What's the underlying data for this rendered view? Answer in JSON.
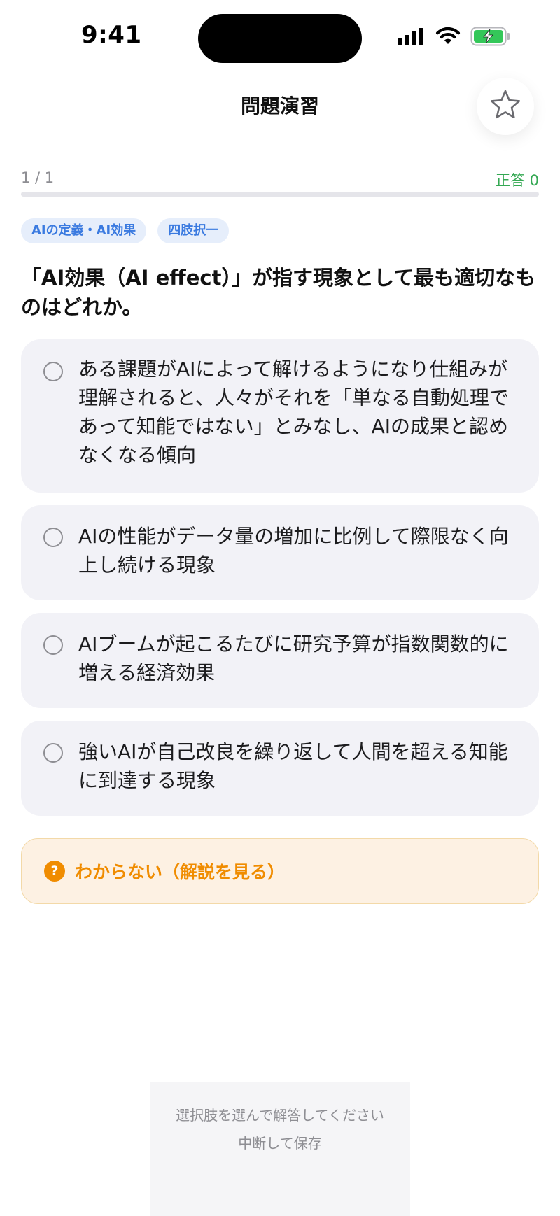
{
  "status_bar": {
    "time": "9:41"
  },
  "header": {
    "title": "問題演習",
    "star_icon": "star-outline-icon"
  },
  "progress": {
    "label": "1 / 1",
    "correct_label": "正答 0",
    "fraction": 0
  },
  "tags": [
    "AIの定義・AI効果",
    "四肢択一"
  ],
  "question": {
    "text": "「AI効果（AI effect）」が指す現象として最も適切なものはどれか。"
  },
  "options": [
    {
      "text": "ある課題がAIによって解けるようになり仕組みが理解されると、人々がそれを「単なる自動処理であって知能ではない」とみなし、AIの成果と認めなくなる傾向"
    },
    {
      "text": "AIの性能がデータ量の増加に比例して際限なく向上し続ける現象"
    },
    {
      "text": "AIブームが起こるたびに研究予算が指数関数的に増える経済効果"
    },
    {
      "text": "強いAIが自己改良を繰り返して人間を超える知能に到達する現象"
    }
  ],
  "dont_know": {
    "icon_glyph": "?",
    "label": "わからない（解説を見る）"
  },
  "bottom": {
    "hint": "選択肢を選んで解答してください",
    "suspend_label": "中断して保存"
  },
  "colors": {
    "accent_blue": "#3a7ae0",
    "correct_green": "#34a853",
    "warning_orange": "#f08c00",
    "option_bg": "#f2f2f7"
  }
}
